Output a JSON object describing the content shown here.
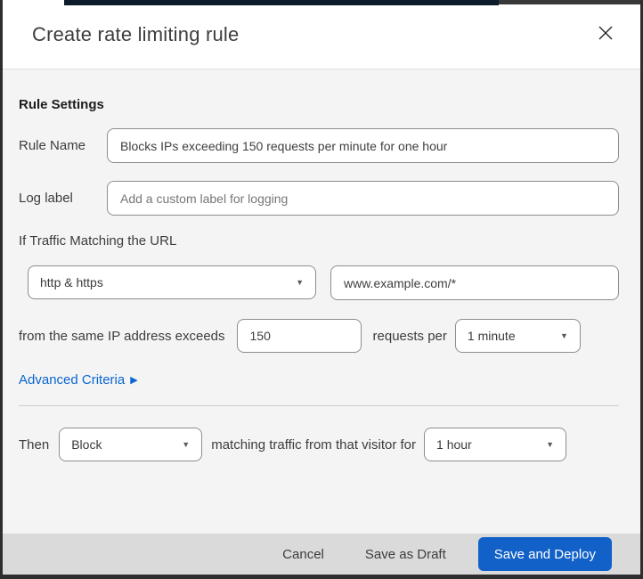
{
  "dialog": {
    "title": "Create rate limiting rule"
  },
  "rule_settings": {
    "heading": "Rule Settings",
    "rule_name": {
      "label": "Rule Name",
      "value": "Blocks IPs exceeding 150 requests per minute for one hour"
    },
    "log_label": {
      "label": "Log label",
      "placeholder": "Add a custom label for logging"
    }
  },
  "traffic_match": {
    "heading": "If Traffic Matching the URL",
    "scheme_select": {
      "value": "http & https"
    },
    "url_input": {
      "value": "www.example.com/*"
    },
    "threshold": {
      "prefix": "from the same IP address exceeds",
      "requests_value": "150",
      "middle": "requests per",
      "period_select": {
        "value": "1 minute"
      }
    },
    "advanced_link": {
      "label": "Advanced Criteria",
      "arrow": "▶"
    }
  },
  "action": {
    "then_label": "Then",
    "action_select": {
      "value": "Block"
    },
    "middle": "matching traffic from that visitor for",
    "duration_select": {
      "value": "1 hour"
    }
  },
  "footer": {
    "cancel": "Cancel",
    "save_draft": "Save as Draft",
    "save_deploy": "Save and Deploy"
  },
  "icons": {
    "caret": "▼"
  },
  "colors": {
    "primary_button_blue": "#1161c8",
    "link_blue": "#0a66d0",
    "body_bg": "#f4f4f4",
    "footer_bg": "#dadada",
    "border_dark": "#2e2e2e",
    "top_strip_navy": "#0d1c2c"
  }
}
